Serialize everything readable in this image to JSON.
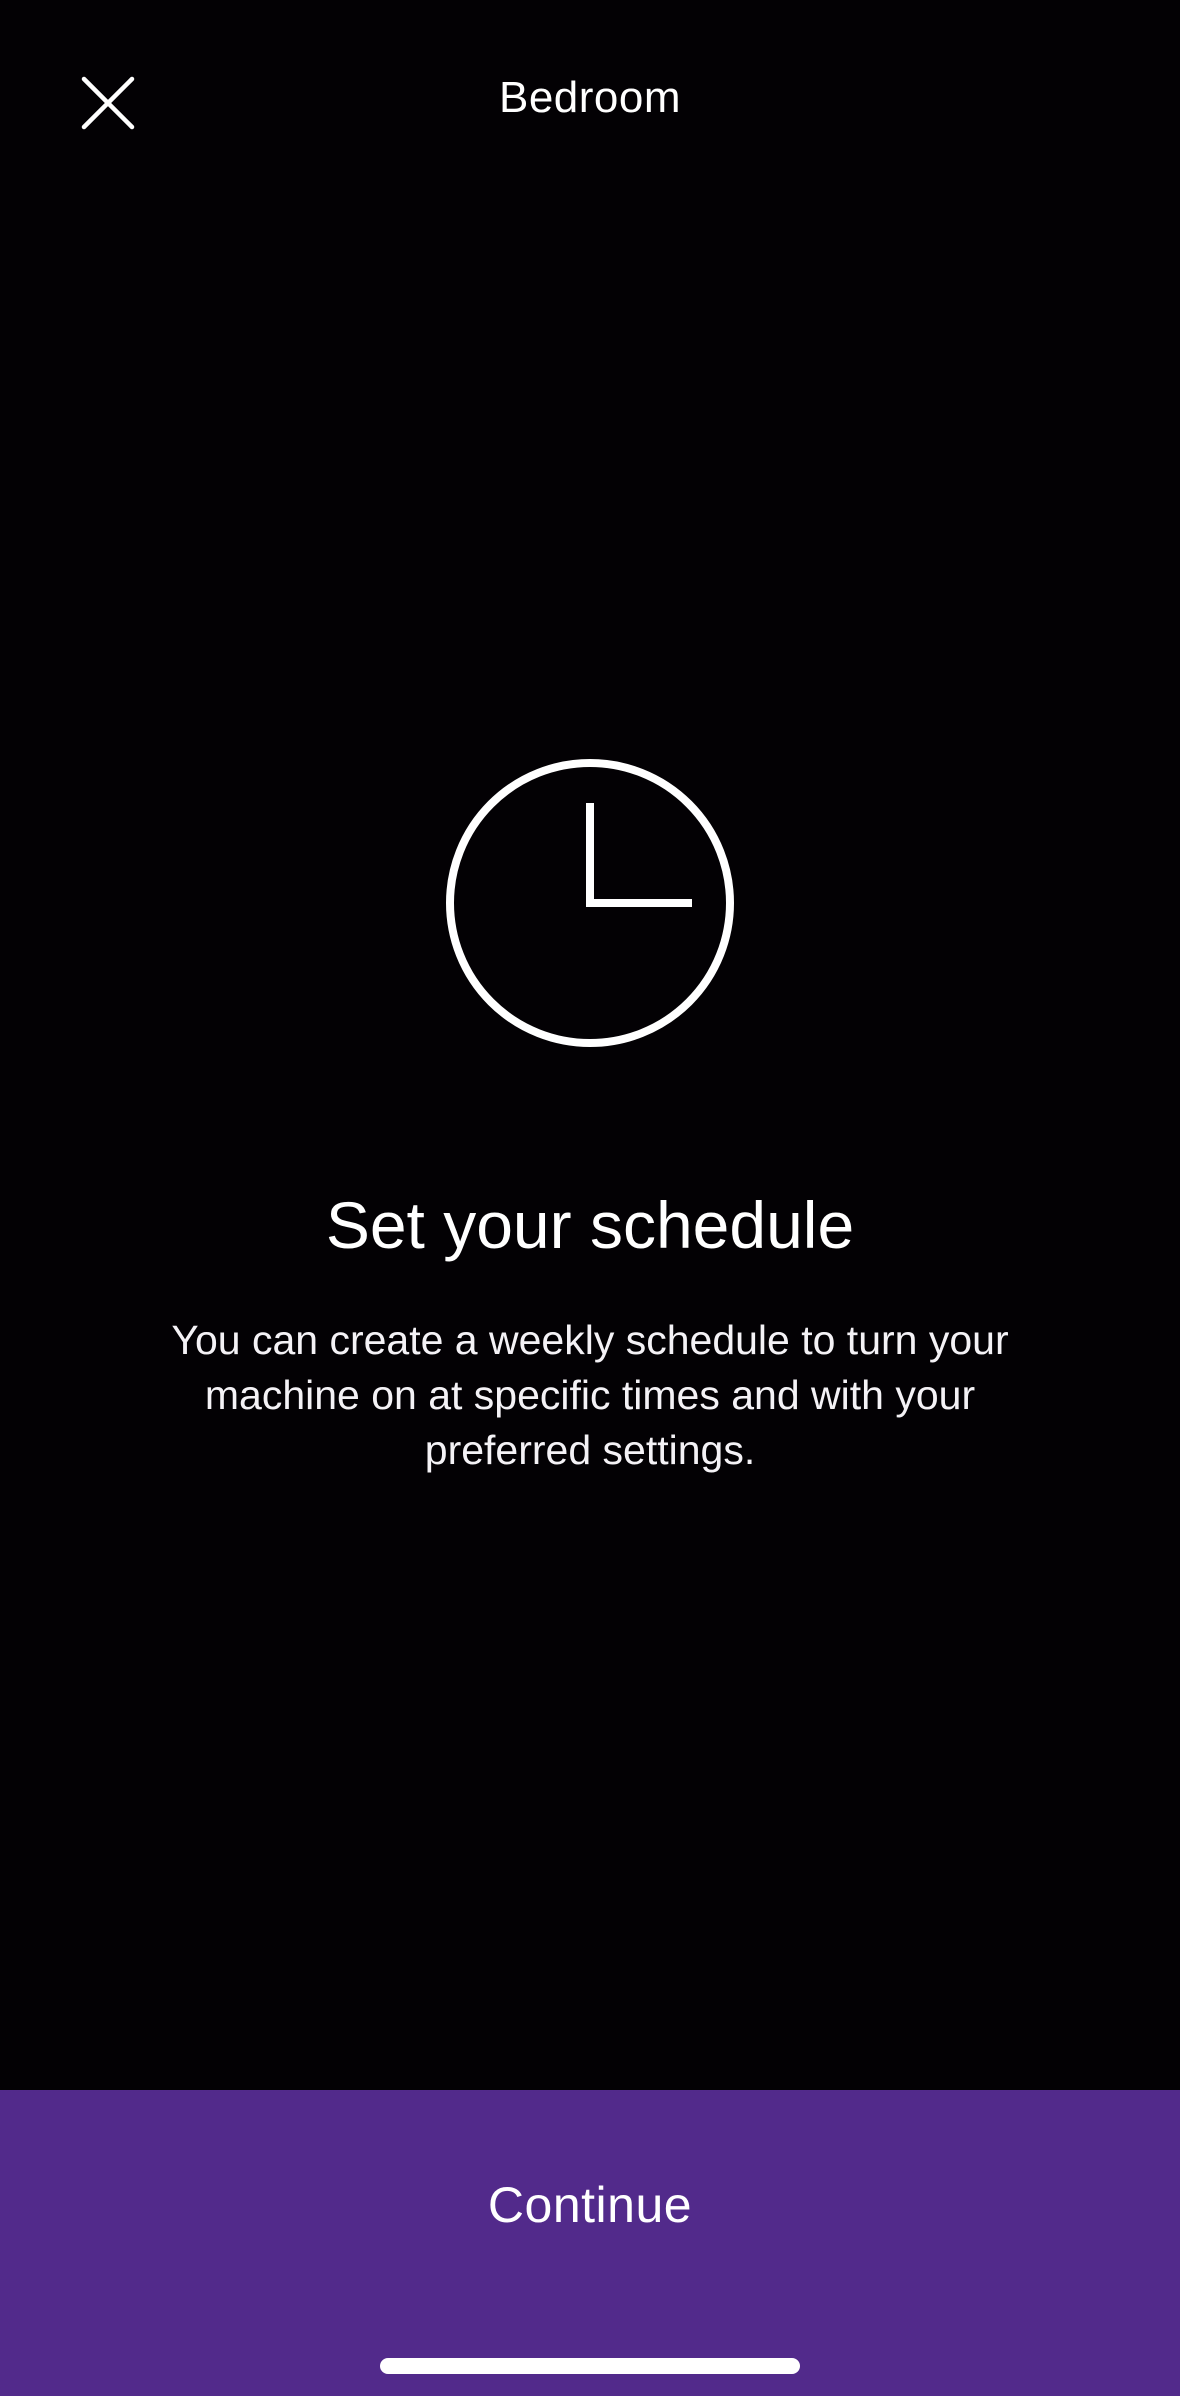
{
  "header": {
    "title": "Bedroom",
    "close_icon": "close-icon"
  },
  "hero": {
    "icon": "clock-icon",
    "headline": "Set your schedule",
    "description": "You can create a weekly schedule to turn your machine on at specific times and with your preferred settings."
  },
  "footer": {
    "continue_label": "Continue",
    "background_color": "#522a8b"
  },
  "colors": {
    "background": "#030104",
    "text": "#ffffff"
  }
}
